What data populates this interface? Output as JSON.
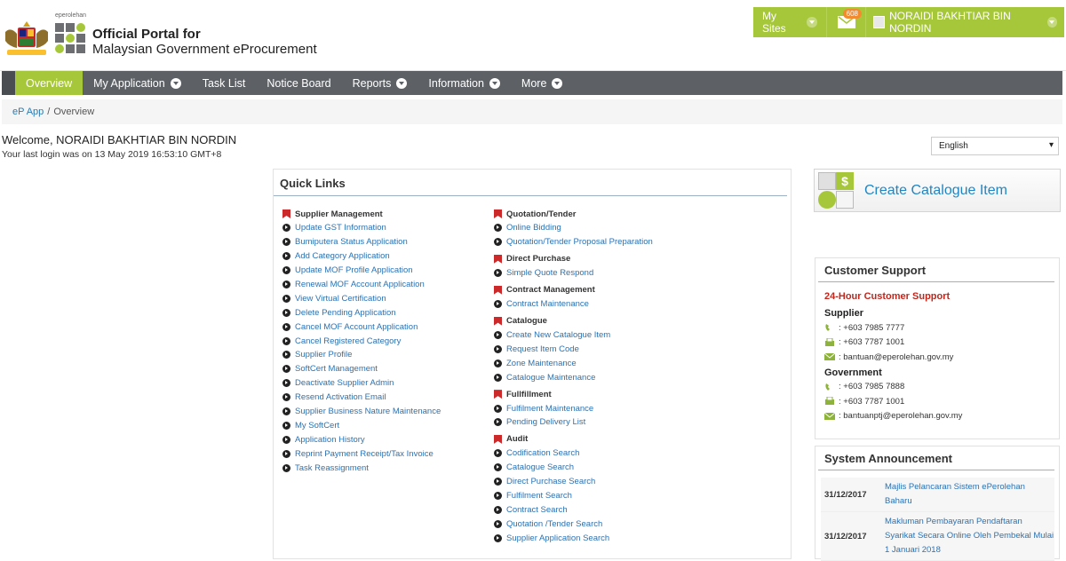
{
  "header": {
    "crest_alt": "",
    "ep_logo_small": "eperolehan",
    "title_line1": "Official Portal for",
    "title_line2": "Malaysian Government eProcurement"
  },
  "topbar": {
    "my_sites": "My Sites",
    "mail_count": "608",
    "user_name": "NORAIDI BAKHTIAR BIN NORDIN"
  },
  "nav": {
    "items": [
      {
        "label": "Overview",
        "active": true,
        "dropdown": false
      },
      {
        "label": "My Application",
        "dropdown": true
      },
      {
        "label": "Task List",
        "dropdown": false
      },
      {
        "label": "Notice Board",
        "dropdown": false
      },
      {
        "label": "Reports",
        "dropdown": true
      },
      {
        "label": "Information",
        "dropdown": true
      },
      {
        "label": "More",
        "dropdown": true
      }
    ]
  },
  "breadcrumb": {
    "root": "eP App",
    "sep": "/",
    "current": "Overview"
  },
  "welcome": {
    "text": "Welcome, NORAIDI BAKHTIAR BIN NORDIN",
    "last_login": "Your last login was on 13 May 2019 16:53:10 GMT+8"
  },
  "language": {
    "selected": "English"
  },
  "quick_links": {
    "title": "Quick Links",
    "left": [
      {
        "group": "Supplier Management",
        "links": [
          "Update GST Information",
          "Bumiputera Status Application",
          "Add Category Application",
          "Update MOF Profile Application",
          "Renewal MOF Account Application",
          "View Virtual Certification",
          "Delete Pending Application",
          "Cancel MOF Account Application",
          "Cancel Registered Category",
          "Supplier Profile",
          "SoftCert Management",
          "Deactivate Supplier Admin",
          "Resend Activation Email",
          "Supplier Business Nature Maintenance",
          "My SoftCert",
          "Application History",
          "Reprint Payment Receipt/Tax Invoice",
          "Task Reassignment"
        ]
      }
    ],
    "right": [
      {
        "group": "Quotation/Tender",
        "links": [
          "Online Bidding",
          "Quotation/Tender Proposal Preparation"
        ]
      },
      {
        "group": "Direct Purchase",
        "links": [
          "Simple Quote Respond"
        ]
      },
      {
        "group": "Contract Management",
        "links": [
          "Contract Maintenance"
        ]
      },
      {
        "group": "Catalogue",
        "links": [
          "Create New Catalogue Item",
          "Request Item Code",
          "Zone Maintenance",
          "Catalogue Maintenance"
        ]
      },
      {
        "group": "Fullfillment",
        "links": [
          "Fulfilment Maintenance",
          "Pending Delivery List"
        ]
      },
      {
        "group": "Audit",
        "links": [
          "Codification Search",
          "Catalogue Search",
          "Direct Purchase Search",
          "Fulfilment Search",
          "Contract Search",
          "Quotation /Tender Search",
          "Supplier Application Search"
        ]
      }
    ]
  },
  "catalogue_button": {
    "label": "Create Catalogue Item"
  },
  "customer_support": {
    "title": "Customer Support",
    "heading": "24-Hour Customer Support",
    "supplier_label": "Supplier",
    "supplier_phone": ": +603 7985 7777",
    "supplier_fax": ": +603 7787 1001",
    "supplier_email": ": bantuan@eperolehan.gov.my",
    "government_label": "Government",
    "government_phone": ": +603 7985 7888",
    "government_fax": ": +603 7787 1001",
    "government_email": ": bantuanptj@eperolehan.gov.my"
  },
  "announcements": {
    "title": "System Announcement",
    "rows": [
      {
        "date": "31/12/2017",
        "text": "Majlis Pelancaran Sistem ePerolehan Baharu"
      },
      {
        "date": "31/12/2017",
        "text": "Makluman Pembayaran Pendaftaran Syarikat Secara Online Oleh Pembekal Mulai 1 Januari 2018"
      }
    ]
  },
  "colors": {
    "accent_green": "#a7c73b",
    "nav_gray": "#5d6166",
    "link_blue": "#2a72b5",
    "support_red": "#c0281e"
  }
}
